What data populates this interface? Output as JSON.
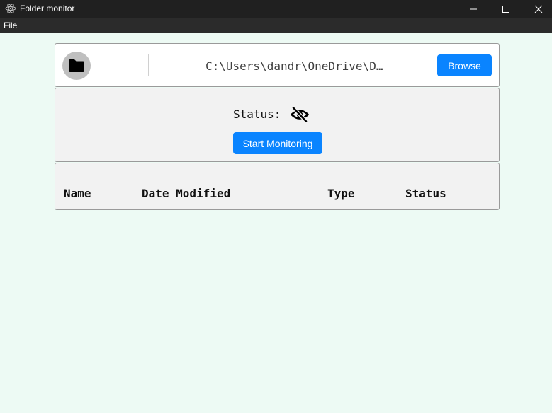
{
  "window": {
    "title": "Folder monitor",
    "icon": "electron-icon",
    "controls": [
      "minimize-icon",
      "maximize-icon",
      "close-icon"
    ]
  },
  "menu": {
    "items": [
      "File"
    ]
  },
  "folder_picker": {
    "icon": "folder-icon",
    "path": "C:\\Users\\dandr\\OneDrive\\D…",
    "browse_label": "Browse"
  },
  "status_panel": {
    "label": "Status:",
    "icon": "eye-slash-icon",
    "start_label": "Start Monitoring"
  },
  "table": {
    "columns": [
      "Name",
      "Date Modified",
      "Type",
      "Status"
    ],
    "rows": []
  },
  "colors": {
    "background": "#edfaf4",
    "accent": "#0a84ff",
    "titlebar": "#202020",
    "menubar": "#2b2b2b"
  }
}
